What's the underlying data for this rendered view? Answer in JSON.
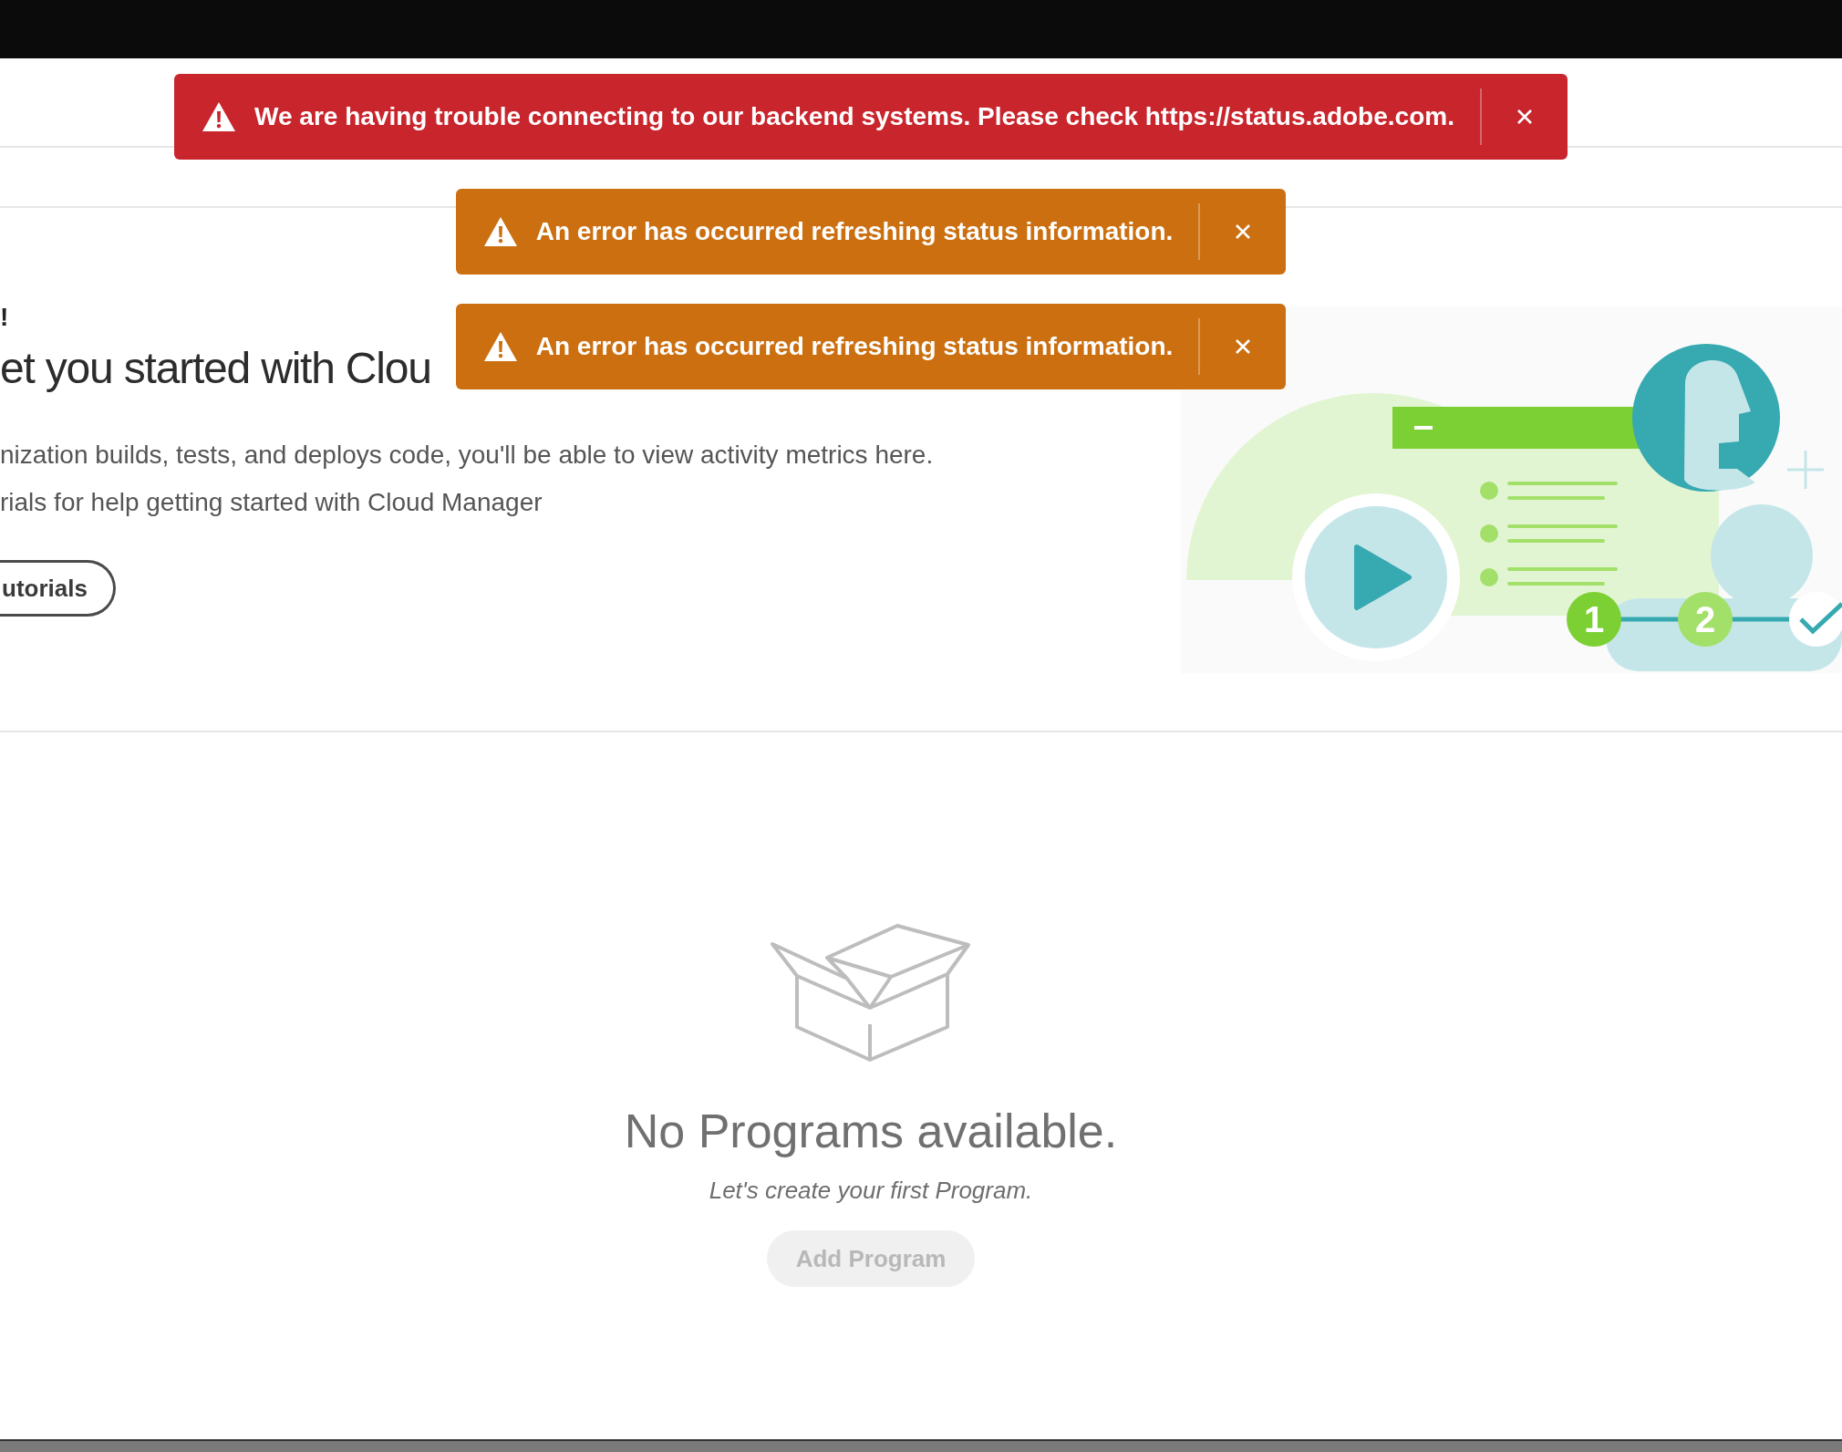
{
  "toasts": [
    {
      "kind": "error",
      "message": "We are having trouble connecting to our backend systems. Please check **https://status.adobe.com**."
    },
    {
      "kind": "warning",
      "message": "An error has occurred refreshing status information."
    },
    {
      "kind": "warning",
      "message": "An error has occurred refreshing status information."
    }
  ],
  "welcome": {
    "title_fragment": "!",
    "heading": "et you started with Clou",
    "paragraphs": [
      "nization builds, tests, and deploys code, you'll be able to view activity metrics here.",
      "rials for help getting started with Cloud Manager"
    ],
    "button": "utorials",
    "steps": [
      "1",
      "2"
    ]
  },
  "empty_state": {
    "title": "No Programs available.",
    "subtitle": "Let's create your first Program.",
    "button": {
      "label": "Add Program",
      "disabled": true
    }
  }
}
